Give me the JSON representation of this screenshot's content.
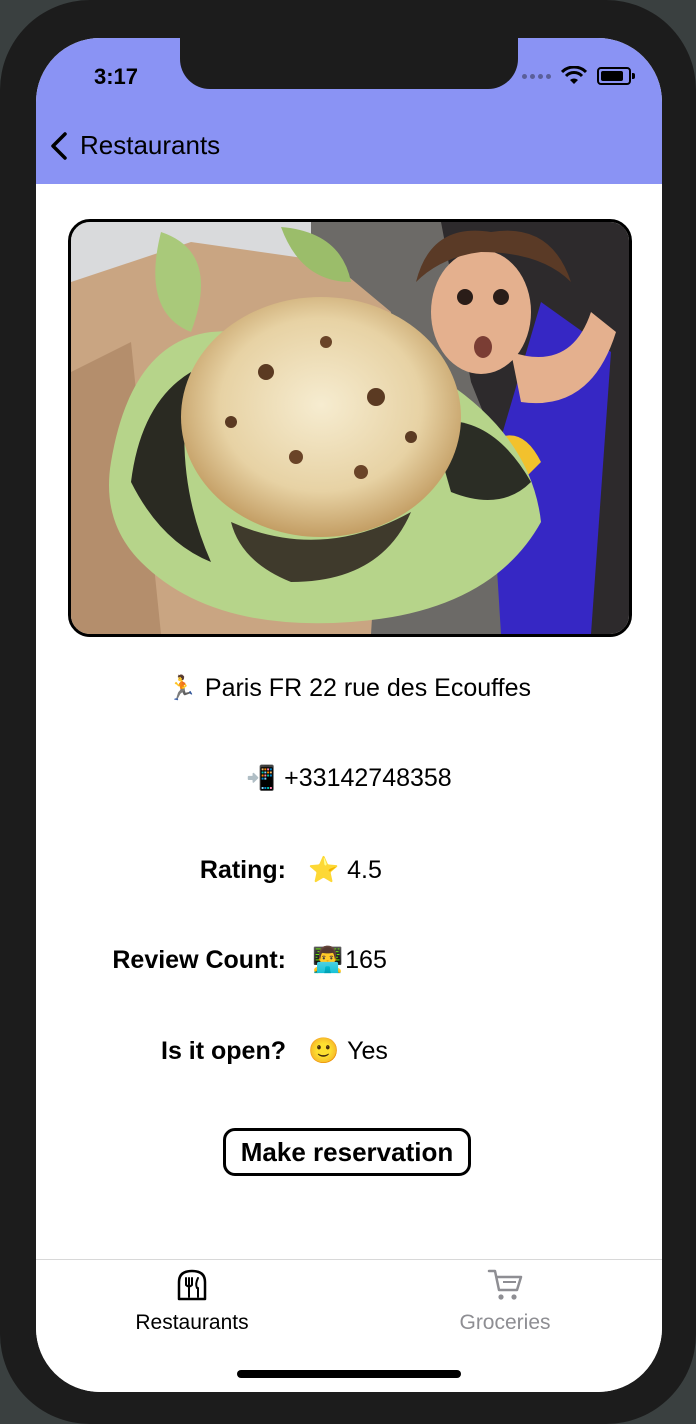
{
  "status_bar": {
    "time": "3:17"
  },
  "nav": {
    "back_label": "Restaurants"
  },
  "details": {
    "address_emoji": "🏃",
    "address": "Paris FR 22 rue des Ecouffes",
    "phone_emoji": "📲",
    "phone": "+33142748358",
    "rating_label": "Rating:",
    "rating_emoji": "⭐",
    "rating_value": "4.5",
    "review_label": "Review Count:",
    "review_emoji": "👨‍💻",
    "review_value": "165",
    "open_label": "Is it open?",
    "open_emoji": "🙂",
    "open_value": "Yes"
  },
  "actions": {
    "reserve_label": "Make reservation"
  },
  "tabs": [
    {
      "label": "Restaurants",
      "icon": "restaurant-icon",
      "active": true
    },
    {
      "label": "Groceries",
      "icon": "cart-icon",
      "active": false
    }
  ],
  "colors": {
    "header": "#8a93f4",
    "tab_active": "#000000",
    "tab_inactive": "#8e8e93"
  }
}
